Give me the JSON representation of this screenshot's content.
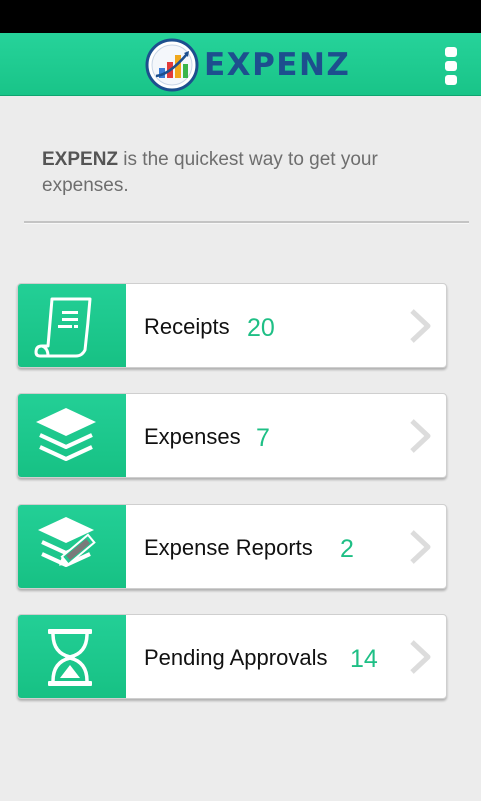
{
  "app": {
    "title": "EXPENZ",
    "accent_color": "#1ec98e",
    "title_color": "#1d4f8e"
  },
  "header": {
    "logo_icon": "bar-chart-logo-icon",
    "menu_icon": "overflow-menu-icon"
  },
  "intro": {
    "brand": "EXPENZ",
    "text": " is the quickest way to get your expenses."
  },
  "menu": [
    {
      "icon": "receipt-icon",
      "label": "Receipts",
      "count": "20"
    },
    {
      "icon": "stack-layers-icon",
      "label": "Expenses",
      "count": "7"
    },
    {
      "icon": "report-edit-icon",
      "label": "Expense Reports",
      "count": "2"
    },
    {
      "icon": "hourglass-icon",
      "label": "Pending Approvals",
      "count": "14"
    }
  ]
}
